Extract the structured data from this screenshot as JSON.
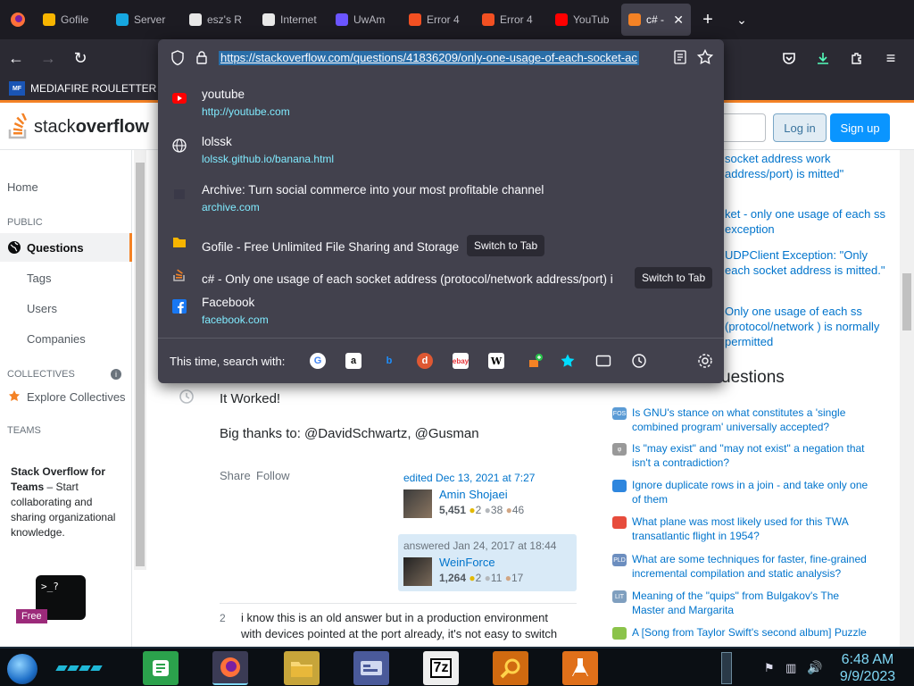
{
  "tabs": [
    {
      "label": "Gofile",
      "color": "#f7b500"
    },
    {
      "label": "Server",
      "color": "#16a7e0"
    },
    {
      "label": "esz's R",
      "color": "#e8e8e8"
    },
    {
      "label": "Internet",
      "color": "#e8e8e8"
    },
    {
      "label": "UwAm",
      "color": "#6b55ff"
    },
    {
      "label": "Error 4",
      "color": "#f25022"
    },
    {
      "label": "Error 4",
      "color": "#f25022"
    },
    {
      "label": "YouTub",
      "color": "#ff0000"
    },
    {
      "label": "c# - ",
      "color": "#f48225",
      "active": true
    }
  ],
  "bookmarks": {
    "icon_text": "MF",
    "label": "MEDIAFIRE ROULETTER"
  },
  "urlbar": {
    "url": "https://stackoverflow.com/questions/41836209/only-one-usage-of-each-socket-ac"
  },
  "suggestions": [
    {
      "title": "youtube",
      "url": "http://youtube.com",
      "icon": "youtube-icon"
    },
    {
      "title": "lolssk",
      "url": "lolssk.github.io/banana.html",
      "icon": "globe-icon"
    },
    {
      "title": "Archive: Turn social commerce into your most profitable channel",
      "url": "archive.com",
      "icon": "archive-icon"
    },
    {
      "title": "Gofile - Free Unlimited File Sharing and Storage",
      "url": "",
      "icon": "gofile-icon",
      "action": "Switch to Tab"
    },
    {
      "title": "c# - Only one usage of each socket address (protocol/network address/port) i",
      "url": "",
      "icon": "stackoverflow-icon",
      "action": "Switch to Tab"
    },
    {
      "title": "Facebook",
      "url": "facebook.com",
      "icon": "facebook-icon"
    }
  ],
  "oneoff": {
    "label": "This time, search with:",
    "engines": [
      "google",
      "amazon",
      "bing",
      "duckduckgo",
      "ebay",
      "wikipedia",
      "add-engine",
      "bookmarks",
      "tabs",
      "history"
    ]
  },
  "so": {
    "logo_a": "stack",
    "logo_b": "overflow",
    "login": "Log in",
    "signup": "Sign up",
    "nav": {
      "home": "Home",
      "public": "PUBLIC",
      "questions": "Questions",
      "tags": "Tags",
      "users": "Users",
      "companies": "Companies",
      "collectives": "COLLECTIVES",
      "explore": "Explore Collectives",
      "teams": "TEAMS",
      "teams_title": "Stack Overflow for Teams",
      "teams_desc": " – Start collaborating and sharing organizational knowledge.",
      "free": "Free"
    },
    "answer": {
      "line1": "It Worked!",
      "line2": "Big thanks to: @DavidSchwartz, @Gusman",
      "share": "Share",
      "follow": "Follow",
      "edited": "edited Dec 13, 2021 at 7:27",
      "editor_name": "Amin Shojaei",
      "editor_rep": "5,451",
      "editor_gold": "2",
      "editor_silver": "38",
      "editor_bronze": "46",
      "answered": "answered Jan 24, 2017 at 18:44",
      "author_name": "WeinForce",
      "author_rep": "1,264",
      "author_gold": "2",
      "author_silver": "11",
      "author_bronze": "17",
      "comment_score": "2",
      "comment_text": "i know this is an old answer but in a production environment with devices pointed at the port already, it's not easy to switch"
    },
    "related": [
      "socket address work address/port) is mitted\"",
      "ket - only one usage of each ss exception",
      "UDPClient Exception: \"Only each socket address is mitted.\"",
      "Only one usage of each ss (protocol/network ) is normally permitted"
    ],
    "hnq_title": "uestions",
    "hnq": [
      {
        "text": "Is GNU's stance on what constitutes a 'single combined program' universally accepted?",
        "icon": "#5b9bd5",
        "tag": "FOS"
      },
      {
        "text": "Is \"may exist\" and \"may not exist\" a negation that isn't a contradiction?",
        "icon": "#999999",
        "tag": "φ"
      },
      {
        "text": "Ignore duplicate rows in a join - and take only one of them",
        "icon": "#2e86de",
        "tag": ""
      },
      {
        "text": "What plane was most likely used for this TWA transatlantic flight in 1954?",
        "icon": "#e74c3c",
        "tag": ""
      },
      {
        "text": "What are some techniques for faster, fine-grained incremental compilation and static analysis?",
        "icon": "#6c8ebf",
        "tag": "PLD"
      },
      {
        "text": "Meaning of the \"quips\" from Bulgakov's The Master and Margarita",
        "icon": "#7f9fbf",
        "tag": "LIT"
      },
      {
        "text": "A [Song from Taylor Swift's second album] Puzzle",
        "icon": "#8bc34a",
        "tag": ""
      }
    ]
  },
  "taskbar": {
    "time": "6:48 AM",
    "date": "9/9/2023"
  }
}
